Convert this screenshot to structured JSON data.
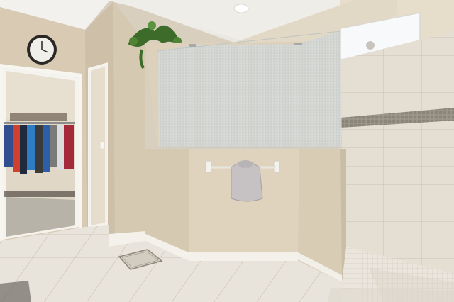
{
  "scene": {
    "description_kind": "photo",
    "palette": {
      "wall": "#dccfb9",
      "wall_shadow": "#c9bba3",
      "ceiling": "#f2f0ec",
      "floor_tile": "#e8e3da",
      "floor_grout": "#cfc8bc",
      "wall_tile": "#e3ddd2",
      "mosaic_band": "#8f8a80",
      "glass": "#cfd3d2",
      "trim": "#f6f4ef",
      "closet_floor": "#b7b2a6"
    },
    "icons": [
      "wall-clock-icon",
      "potted-plant-icon",
      "ceiling-light-icon",
      "towel-bar-icon",
      "floor-drain-icon"
    ]
  }
}
